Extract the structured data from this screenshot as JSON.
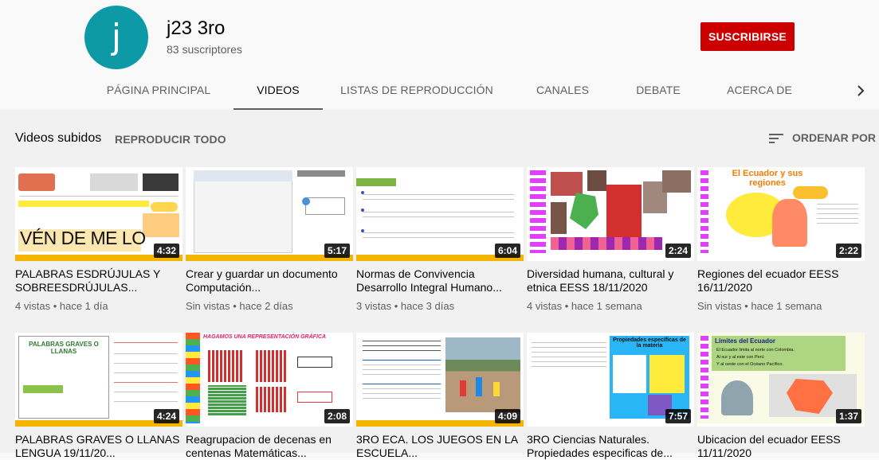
{
  "channel": {
    "avatar_letter": "j",
    "name": "j23 3ro",
    "subscribers": "83 suscriptores",
    "subscribe_label": "SUSCRIBIRSE"
  },
  "tabs": [
    {
      "label": "PÁGINA PRINCIPAL"
    },
    {
      "label": "VIDEOS"
    },
    {
      "label": "LISTAS DE REPRODUCCIÓN"
    },
    {
      "label": "CANALES"
    },
    {
      "label": "DEBATE"
    },
    {
      "label": "ACERCA DE"
    }
  ],
  "section": {
    "title": "Videos subidos",
    "play_all": "REPRODUCIR TODO",
    "sort_label": "ORDENAR POR"
  },
  "videos": [
    {
      "title": "PALABRAS ESDRÚJULAS Y SOBREESDRÚJULAS...",
      "views": "4 vistas",
      "age": "hace 1 día",
      "duration": "4:32"
    },
    {
      "title": "Crear y guardar un documento Computación...",
      "views": "Sin vistas",
      "age": "hace 2 días",
      "duration": "5:17"
    },
    {
      "title": "Normas de Convivencia Desarrollo Integral Humano...",
      "views": "3 vistas",
      "age": "hace 3 días",
      "duration": "6:04"
    },
    {
      "title": "Diversidad humana, cultural y etnica EESS 18/11/2020",
      "views": "4 vistas",
      "age": "hace 1 semana",
      "duration": "2:24"
    },
    {
      "title": "Regiones del ecuador EESS 16/11/2020",
      "views": "Sin vistas",
      "age": "hace 1 semana",
      "duration": "2:22"
    },
    {
      "title": "PALABRAS GRAVES O LLANAS LENGUA 19/11/20...",
      "views": "",
      "age": "",
      "duration": "4:24"
    },
    {
      "title": "Reagrupacion de decenas en centenas Matemáticas...",
      "views": "",
      "age": "",
      "duration": "2:08"
    },
    {
      "title": "3RO ECA. LOS JUEGOS EN LA ESCUELA...",
      "views": "",
      "age": "",
      "duration": "4:09"
    },
    {
      "title": "3RO Ciencias Naturales. Propiedades especificas de...",
      "views": "",
      "age": "",
      "duration": "7:57"
    },
    {
      "title": "Ubicacion del ecuador EESS 11/11/2020",
      "views": "",
      "age": "",
      "duration": "1:37"
    }
  ],
  "thumb_text": {
    "v1": {
      "word": "VÉN DE ME LO"
    },
    "v5": {
      "heading": "El Ecuador y sus regiones"
    },
    "v6": {
      "heading": "PALABRAS GRAVES O LLANAS"
    },
    "v7": {
      "heading": "HAGAMOS UNA REPRESENTACIÓN GRÁFICA"
    },
    "v9": {
      "heading": "Propiedades específicas de la materia"
    },
    "v10": {
      "heading": "Límites del Ecuador",
      "line1": "El Ecuador limita al norte con Colombia.",
      "line2": "Al sur y al este con Perú",
      "line3": "Y al oeste con el Océano Pacífico."
    }
  },
  "colors": {
    "accent_red": "#cc0000",
    "avatar": "#0d9aa6",
    "thumb_bar": "#f4b400"
  }
}
